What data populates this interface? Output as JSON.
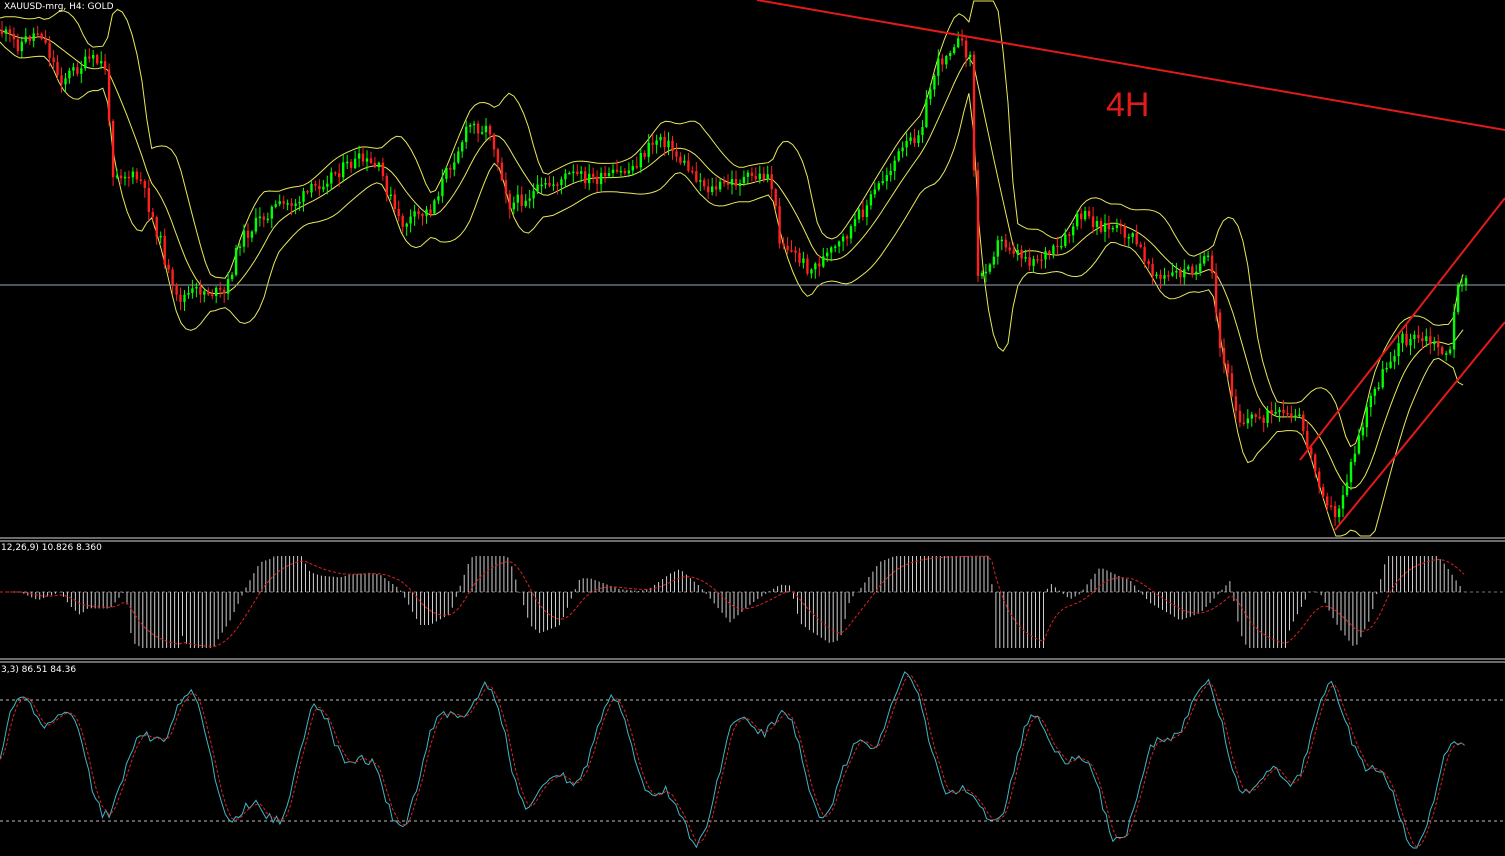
{
  "window": {
    "symbol_label": "XAUUSD-mrg, H4:  GOLD",
    "timeframe_note": "4H"
  },
  "panels": {
    "macd_label": "12,26,9) 10.826 8.360",
    "stoch_label": "3,3) 86.51 84.36"
  },
  "colors": {
    "background": "#000000",
    "bull_candle": "#00ff00",
    "bear_candle": "#ff2020",
    "bollinger": "#e8e85a",
    "trendline": "#e11a1a",
    "macd_hist": "#cfcfcf",
    "macd_signal": "#e02020",
    "stoch_main": "#3fb6c6",
    "stoch_signal": "#e02020",
    "hline": "#9aa6b4",
    "separator": "#d8d8d8"
  },
  "chart_data": [
    {
      "type": "candlestick",
      "title": "XAUUSD-mrg, H4:  GOLD",
      "annotation": "4H",
      "indicators": [
        "Bollinger Bands",
        "trend channel",
        "horizontal line"
      ],
      "grid": false
    },
    {
      "type": "bar",
      "title": "12,26,9) 10.826 8.360",
      "series": [
        {
          "name": "MACD",
          "last": 10.826
        },
        {
          "name": "Signal",
          "last": 8.36
        }
      ]
    },
    {
      "type": "line",
      "title": "3,3) 86.51 84.36",
      "series": [
        {
          "name": "%K",
          "last": 86.51
        },
        {
          "name": "%D",
          "last": 84.36
        }
      ],
      "levels": [
        80,
        20
      ]
    }
  ]
}
